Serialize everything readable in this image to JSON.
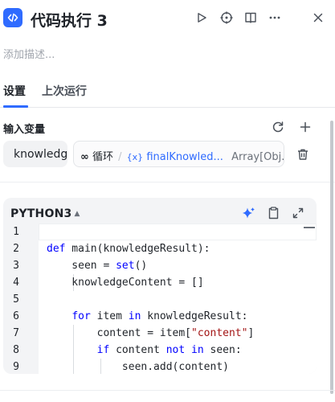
{
  "header": {
    "title": "代码执行 3",
    "icons": [
      "code-node-icon",
      "play-icon",
      "crosshair-icon",
      "book-icon",
      "more-icon",
      "close-icon"
    ]
  },
  "description": {
    "placeholder": "添加描述..."
  },
  "tabs": [
    {
      "label": "设置",
      "active": true
    },
    {
      "label": "上次运行",
      "active": false
    }
  ],
  "inputs": {
    "section_title": "输入变量",
    "variable": {
      "name": "knowledge",
      "loop_symbol": "∞",
      "loop_label": "循环",
      "separator": "/",
      "ref_symbol": "{x}",
      "ref_name": "finalKnowled...",
      "type": "Array[Obj..."
    }
  },
  "editor": {
    "language": "PYTHON3",
    "lines": [
      {
        "num": "1",
        "html": ""
      },
      {
        "num": "2",
        "html": "<span class=\"kw\">def</span> main(knowledgeResult):"
      },
      {
        "num": "3",
        "html": "    seen = <span class=\"kw\">set</span>()"
      },
      {
        "num": "4",
        "html": "    knowledgeContent = []"
      },
      {
        "num": "5",
        "html": ""
      },
      {
        "num": "6",
        "html": "    <span class=\"kw\">for</span> item <span class=\"kw\">in</span> knowledgeResult:"
      },
      {
        "num": "7",
        "html": "        content = item[<span class=\"str\">\"content\"</span>]"
      },
      {
        "num": "8",
        "html": "        <span class=\"kw\">if</span> content <span class=\"kw\">not</span> <span class=\"kw\">in</span> seen:"
      },
      {
        "num": "9",
        "html": "            seen.add(content)"
      }
    ]
  },
  "colors": {
    "accent": "#2f6bff",
    "keyword": "#0000ff",
    "string": "#a31515"
  }
}
